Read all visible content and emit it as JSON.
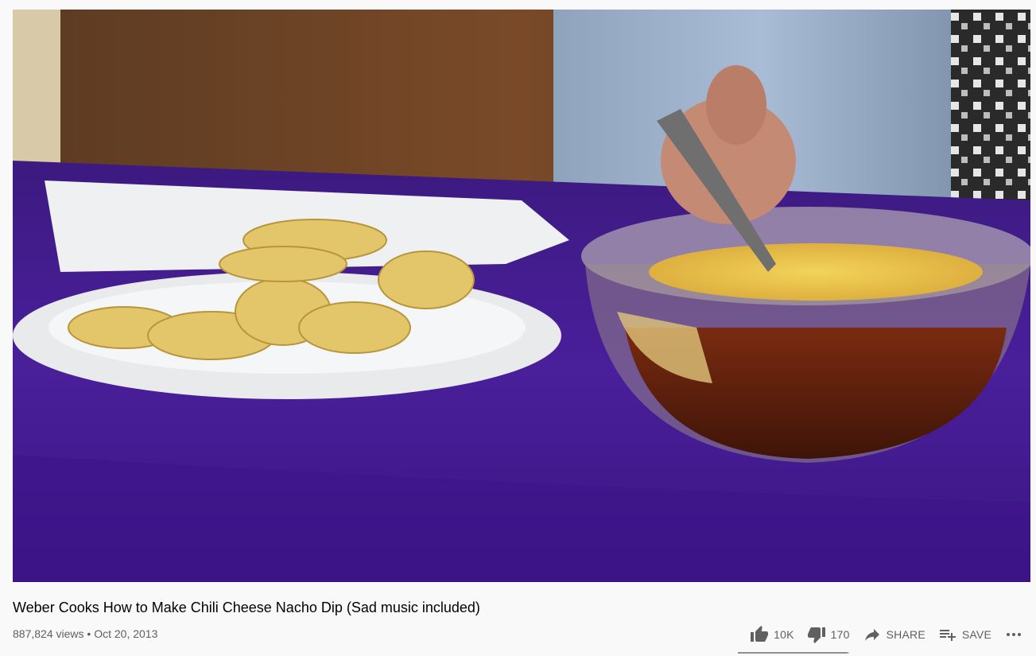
{
  "video": {
    "title": "Weber Cooks How to Make Chili Cheese Nacho Dip (Sad music included)",
    "views": "887,824 views",
    "separator": "•",
    "date": "Oct 20, 2013"
  },
  "actions": {
    "like": {
      "icon": "thumb-up-icon",
      "label": "10K"
    },
    "dislike": {
      "icon": "thumb-down-icon",
      "label": "170"
    },
    "share": {
      "icon": "share-icon",
      "label": "SHARE"
    },
    "save": {
      "icon": "playlist-add-icon",
      "label": "SAVE"
    },
    "more": {
      "icon": "more-horizontal-icon"
    }
  },
  "sentiment": {
    "like_ratio": 0.983
  },
  "colors": {
    "background": "#f9f9f9",
    "text_primary": "#030303",
    "text_secondary": "#606060",
    "tablecloth": "#4a1d9a",
    "icon": "#606060"
  }
}
